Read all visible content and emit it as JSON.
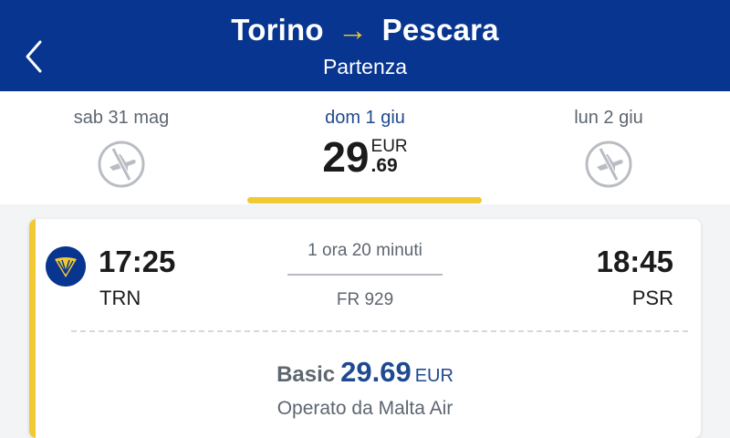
{
  "header": {
    "origin": "Torino",
    "arrow": "→",
    "destination": "Pescara",
    "subtitle": "Partenza",
    "back_icon": "chevron-left-icon"
  },
  "dates": [
    {
      "label": "sab 31 mag",
      "available": false,
      "icon": "no-flight-icon"
    },
    {
      "label": "dom 1 giu",
      "available": true,
      "price_int": "29",
      "price_dec": ".69",
      "currency": "EUR",
      "selected": true
    },
    {
      "label": "lun 2 giu",
      "available": false,
      "icon": "no-flight-icon"
    }
  ],
  "flight": {
    "airline_logo": "ryanair-harp-icon",
    "depart_time": "17:25",
    "depart_code": "TRN",
    "duration": "1 ora 20 minuti",
    "flight_number": "FR 929",
    "arrive_time": "18:45",
    "arrive_code": "PSR",
    "fare_name": "Basic",
    "fare_price": "29.69",
    "fare_currency": "EUR",
    "operated_by": "Operato da Malta Air"
  },
  "colors": {
    "brand_blue": "#073590",
    "accent_yellow": "#f1c933",
    "text_gray": "#5e6670",
    "price_blue": "#1f4a8f"
  }
}
